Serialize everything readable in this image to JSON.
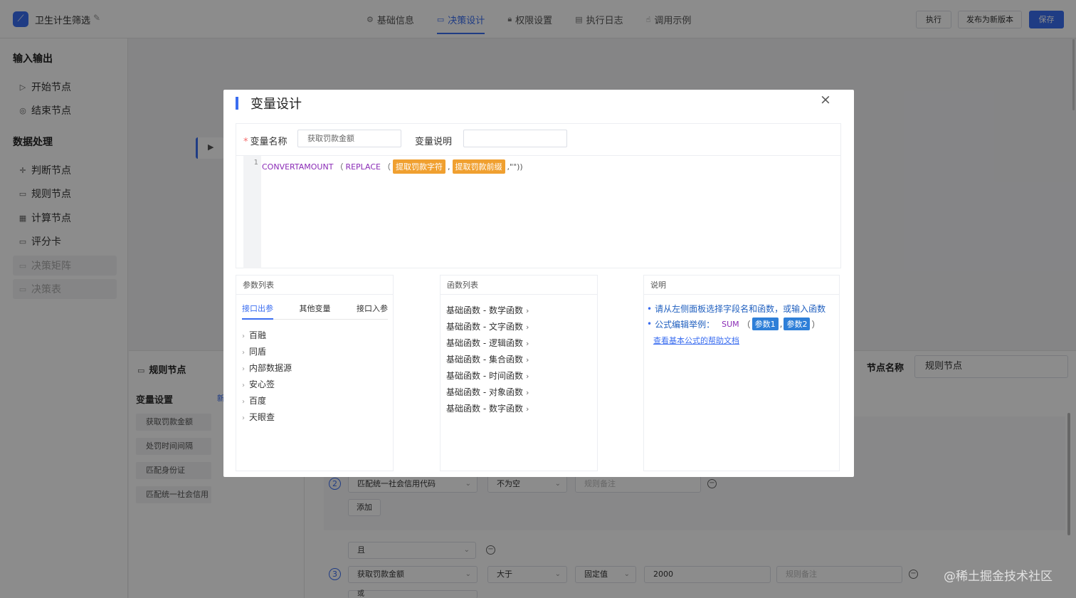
{
  "header": {
    "app_title": "卫生计生筛选",
    "tabs": [
      {
        "label": "基础信息",
        "icon": "gear-icon"
      },
      {
        "label": "决策设计",
        "icon": "chat-icon"
      },
      {
        "label": "权限设置",
        "icon": "lock-icon"
      },
      {
        "label": "执行日志",
        "icon": "document-icon"
      },
      {
        "label": "调用示例",
        "icon": "hand-icon"
      }
    ],
    "active_tab": "决策设计",
    "btn_execute": "执行",
    "btn_publish": "发布为新版本",
    "btn_save": "保存",
    "accent": "#3a6df0"
  },
  "sidebar": {
    "io_title": "输入输出",
    "io_items": [
      "开始节点",
      "结束节点"
    ],
    "proc_title": "数据处理",
    "proc_items": [
      "判断节点",
      "规则节点",
      "计算节点",
      "评分卡"
    ],
    "disabled_items": [
      "决策矩阵",
      "决策表"
    ]
  },
  "bottom": {
    "panel_title": "规则节点",
    "var_setting": "变量设置",
    "new_label": "新",
    "vars": [
      "获取罚款金额",
      "处罚时间间隔",
      "匹配身份证",
      "匹配统一社会信用"
    ],
    "node_name_label": "节点名称",
    "node_name_value": "规则节点",
    "rules": {
      "row2_num": "2",
      "row2_field": "匹配统一社会信用代码",
      "row2_op": "不为空",
      "row2_note_ph": "规则备注",
      "add": "添加",
      "logic": "且",
      "row3_num": "3",
      "row3_field": "获取罚款金额",
      "row3_op": "大于",
      "row3_type": "固定值",
      "row3_value": "2000",
      "row3_note_ph": "规则备注",
      "row4_partial": "或"
    }
  },
  "modal": {
    "title": "变量设计",
    "var_name_label": "变量名称",
    "var_name_value": "获取罚款金额",
    "var_desc_label": "变量说明",
    "var_desc_value": "",
    "line_no": "1",
    "code": {
      "fn1": "CONVERTAMOUNT",
      "fn2": "REPLACE",
      "chip1": "提取罚款字符",
      "chip2": "提取罚款前缀",
      "tail": ",\"\"))"
    },
    "params_panel": {
      "title": "参数列表",
      "tabs": [
        "接口出参",
        "其他变量",
        "接口入参"
      ],
      "items": [
        "百融",
        "同盾",
        "内部数据源",
        "安心签",
        "百度",
        "天眼查"
      ]
    },
    "functions_panel": {
      "title": "函数列表",
      "items": [
        "基础函数 - 数学函数",
        "基础函数 - 文字函数",
        "基础函数 - 逻辑函数",
        "基础函数 - 集合函数",
        "基础函数 - 时间函数",
        "基础函数 - 对象函数",
        "基础函数 - 数字函数"
      ]
    },
    "notes_panel": {
      "title": "说明",
      "line1": "请从左侧面板选择字段名和函数，或输入函数",
      "line2": "公式编辑举例：",
      "sum": "SUM",
      "p1": "参数1",
      "p2": "参数2",
      "link": "查看基本公式的帮助文档"
    }
  },
  "watermark": "@稀土掘金技术社区"
}
